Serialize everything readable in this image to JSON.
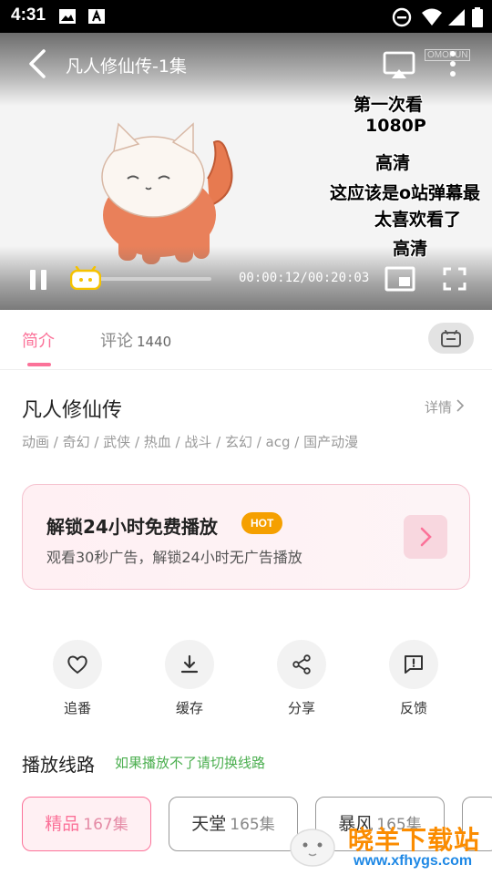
{
  "status_bar": {
    "time": "4:31"
  },
  "player": {
    "title": "凡人修仙传-1集",
    "watermark": "OMOFUN",
    "danmaku": [
      "第一次看",
      "1080P",
      "高清",
      "这应该是o站弹幕最",
      "太喜欢看了",
      "高清"
    ],
    "time_display": "00:00:12/00:20:03",
    "progress_fraction": 0.01
  },
  "tabs": {
    "intro_label": "简介",
    "comments_label": "评论",
    "comments_count": "1440"
  },
  "anime": {
    "title": "凡人修仙传",
    "detail_label": "详情",
    "tags": "动画 / 奇幻 / 武侠 / 热血 / 战斗 / 玄幻 / acg / 国产动漫"
  },
  "promo": {
    "title": "解锁24小时免费播放",
    "badge": "HOT",
    "subtitle": "观看30秒广告，解锁24小时无广告播放"
  },
  "actions": [
    {
      "label": "追番",
      "icon": "heart-icon"
    },
    {
      "label": "缓存",
      "icon": "download-icon"
    },
    {
      "label": "分享",
      "icon": "share-icon"
    },
    {
      "label": "反馈",
      "icon": "feedback-icon"
    }
  ],
  "lines": {
    "title": "播放线路",
    "hint": "如果播放不了请切换线路",
    "items": [
      {
        "name": "精品",
        "episodes": "167集"
      },
      {
        "name": "天堂",
        "episodes": "165集"
      },
      {
        "name": "暴风",
        "episodes": "165集"
      }
    ]
  },
  "site_watermark": {
    "name": "晓羊下载站",
    "url": "www.xfhygs.com"
  },
  "colors": {
    "accent": "#fb7299",
    "hot": "#f5a000",
    "hint": "#4caf50"
  }
}
